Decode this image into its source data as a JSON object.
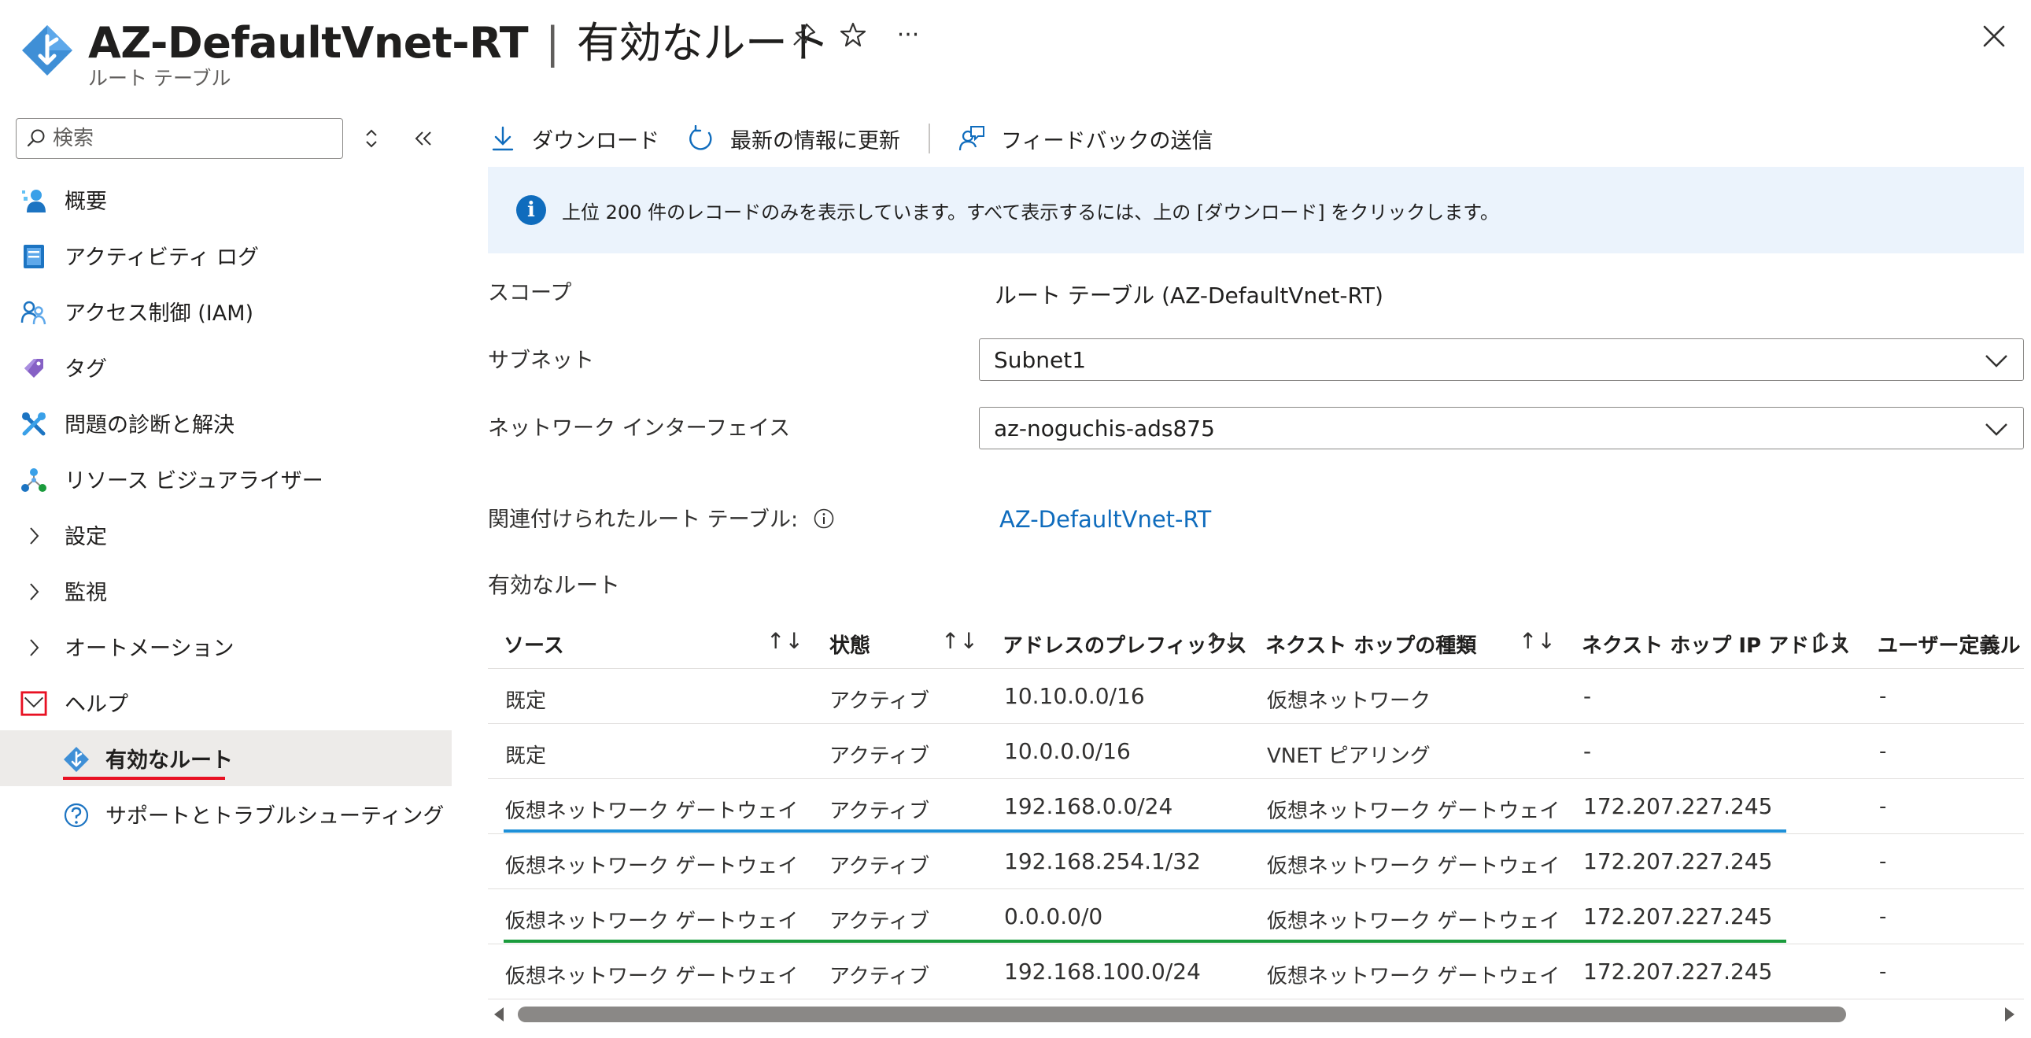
{
  "header": {
    "resource_name": "AZ-DefaultVnet-RT",
    "separator": "|",
    "page_title": "有効なルート",
    "subtitle": "ルート テーブル",
    "more_label": "···"
  },
  "sidebar": {
    "search_placeholder": "検索",
    "items": [
      {
        "label": "概要",
        "icon": "overview-icon"
      },
      {
        "label": "アクティビティ ログ",
        "icon": "activity-log-icon"
      },
      {
        "label": "アクセス制御 (IAM)",
        "icon": "iam-icon"
      },
      {
        "label": "タグ",
        "icon": "tag-icon"
      },
      {
        "label": "問題の診断と解決",
        "icon": "diagnose-icon"
      },
      {
        "label": "リソース ビジュアライザー",
        "icon": "resource-visualizer-icon"
      },
      {
        "label": "設定",
        "icon": "chevron-right-icon"
      },
      {
        "label": "監視",
        "icon": "chevron-right-icon"
      },
      {
        "label": "オートメーション",
        "icon": "chevron-right-icon"
      },
      {
        "label": "ヘルプ",
        "icon": "chevron-down-icon"
      },
      {
        "label": "有効なルート",
        "icon": "route-table-icon"
      },
      {
        "label": "サポートとトラブルシューティング",
        "icon": "help-icon"
      }
    ]
  },
  "toolbar": {
    "download": "ダウンロード",
    "refresh": "最新の情報に更新",
    "feedback": "フィードバックの送信"
  },
  "info": {
    "message": "上位 200 件のレコードのみを表示しています。すべて表示するには、上の [ダウンロード] をクリックします。"
  },
  "form": {
    "scope_label": "スコープ",
    "scope_value": "ルート テーブル (AZ-DefaultVnet-RT)",
    "subnet_label": "サブネット",
    "subnet_value": "Subnet1",
    "nic_label": "ネットワーク インターフェイス",
    "nic_value": "az-noguchis-ads875",
    "assoc_label": "関連付けられたルート テーブル:",
    "assoc_value": "AZ-DefaultVnet-RT"
  },
  "routes": {
    "title": "有効なルート",
    "columns": [
      "ソース",
      "状態",
      "アドレスのプレフィックス",
      "ネクスト ホップの種類",
      "ネクスト ホップ IP アドレス",
      "ユーザー定義ル"
    ],
    "sort_glyph": "↑↓",
    "rows": [
      [
        "既定",
        "アクティブ",
        "10.10.0.0/16",
        "仮想ネットワーク",
        "-",
        "-"
      ],
      [
        "既定",
        "アクティブ",
        "10.0.0.0/16",
        "VNET ピアリング",
        "-",
        "-"
      ],
      [
        "仮想ネットワーク ゲートウェイ",
        "アクティブ",
        "192.168.0.0/24",
        "仮想ネットワーク ゲートウェイ",
        "172.207.227.245",
        "-"
      ],
      [
        "仮想ネットワーク ゲートウェイ",
        "アクティブ",
        "192.168.254.1/32",
        "仮想ネットワーク ゲートウェイ",
        "172.207.227.245",
        "-"
      ],
      [
        "仮想ネットワーク ゲートウェイ",
        "アクティブ",
        "0.0.0.0/0",
        "仮想ネットワーク ゲートウェイ",
        "172.207.227.245",
        "-"
      ],
      [
        "仮想ネットワーク ゲートウェイ",
        "アクティブ",
        "192.168.100.0/24",
        "仮想ネットワーク ゲートウェイ",
        "172.207.227.245",
        "-"
      ]
    ]
  },
  "colors": {
    "accent": "#0f6cbd",
    "highlight_red": "#e81123",
    "highlight_blue": "#1e90d8",
    "highlight_green": "#1a9b3c"
  }
}
